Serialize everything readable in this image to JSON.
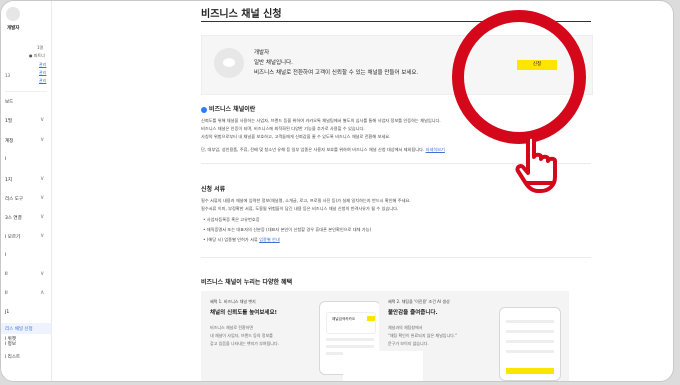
{
  "sidebar": {
    "name": "개발자",
    "small_label": "1명",
    "small_sub": "● 파트너",
    "links": [
      "관리",
      "관리",
      "관리"
    ],
    "side_label": "13",
    "items": [
      {
        "label": "보드",
        "chevron": ""
      },
      {
        "label": "1필",
        "chevron": "∨"
      },
      {
        "label": "계정",
        "chevron": "∨"
      },
      {
        "label": "I",
        "chevron": ""
      },
      {
        "label": "1지",
        "chevron": "∨"
      },
      {
        "label": "리스 도구",
        "chevron": "∨"
      },
      {
        "label": "3스 연결",
        "chevron": "∨"
      },
      {
        "label": "I 모르기",
        "chevron": "∨"
      },
      {
        "label": "I",
        "chevron": ""
      },
      {
        "label": "Il",
        "chevron": "∨"
      },
      {
        "label": "Il",
        "chevron": "∧"
      },
      {
        "label": "J1",
        "chevron": ""
      },
      {
        "label": "l 그룹",
        "chevron": ""
      },
      {
        "label": "l 위젯",
        "chevron": ""
      },
      {
        "label": "리스 채널 신청",
        "chevron": ""
      },
      {
        "label": "l 정보",
        "chevron": ""
      },
      {
        "label": "l 리스트",
        "chevron": ""
      }
    ]
  },
  "main": {
    "title": "비즈니스 채널 신청",
    "card": {
      "line1": "개발자",
      "line2": "일반 채널입니다.",
      "line3": "비즈니스 채널로 전환하여 고객이 신뢰할 수 있는 채널을 만들어 보세요.",
      "button": "신청"
    },
    "section1": {
      "heading": "비즈니스 채널이란",
      "lines": [
        "신뢰도를 위해 채널을 사용하는 사업자, 브랜드 등을 위하여 카카오톡 채널팀에서 별도의 심사를 통해 사업자 정보를 인증하는 채널입니다.",
        "비즈니스 채널은 인증이 되며, 비즈니스에 최적화된 다양한 기능을 추가로 사용할 수 있습니다.",
        "사칭의 위험으로부터 내 채널을 보호하고, 고객들에게 신뢰감을 줄 수 있도록 비즈니스 채널로 전환해 보세요."
      ],
      "note": "단, 대부업, 성인용품, 주류, 전배 및 청소년 유해 등 일부 업종은 사용자 보호를 위하여 비즈니스 채널 신청 대상에서 제외됩니다.",
      "note_link": "자세히보기"
    },
    "section2": {
      "heading": "신청 서류",
      "lines": [
        "필수 서류의 내용과 채널에 입력한 정보(채널명, 소개글, 로고, 프로필 사진 등)가 실제 일치하는지 반드시 확인해 주세요.",
        "필수서류 이미, 부정확한 서류, 도용될 위험들이 담긴 내용 등은 비즈니스 채널 신청의 반려사유가 될 수 있습니다."
      ],
      "bullets": [
        "• 사업자등록증 혹은 고유번호증",
        "• 재직증명서 또는 대표자의 신분증 (대표자 본인이 신청할 경우 휴대폰 본인확인으로 대체 가능)",
        "• (해당 시) 업종별 인허가 서류"
      ],
      "bullet_link": "업종별 안내"
    },
    "section3": {
      "heading": "비즈니스 채널이 누리는 다양한 혜택",
      "benefits": [
        {
          "tag": "혜택 1. 비즈니스 채널 뱃지",
          "head": "채널의 신뢰도를 높여보세요!",
          "body": [
            "비즈니스 채널로 전환하면",
            "내 채널이 사업자, 브랜드 등의 정보를",
            "갖고 있음을 나타내는 뱃지가 부여됩니다."
          ],
          "phone_title": "채널검색카카오"
        },
        {
          "tag": "혜택 2. 채팅을 '이진용' 조건 AI 생성",
          "head": "불안감을 줄여줍니다.",
          "body": [
            "채널과의 채팅창에서",
            "\"채팅 확인이 완료되지 않은 채널입니다.\"",
            "문구가 보이지 않습니다."
          ],
          "phone_title": ""
        }
      ]
    }
  },
  "colors": {
    "accent_yellow": "#fee500",
    "highlight_red": "#d5071a",
    "link_blue": "#3f6fd6"
  }
}
